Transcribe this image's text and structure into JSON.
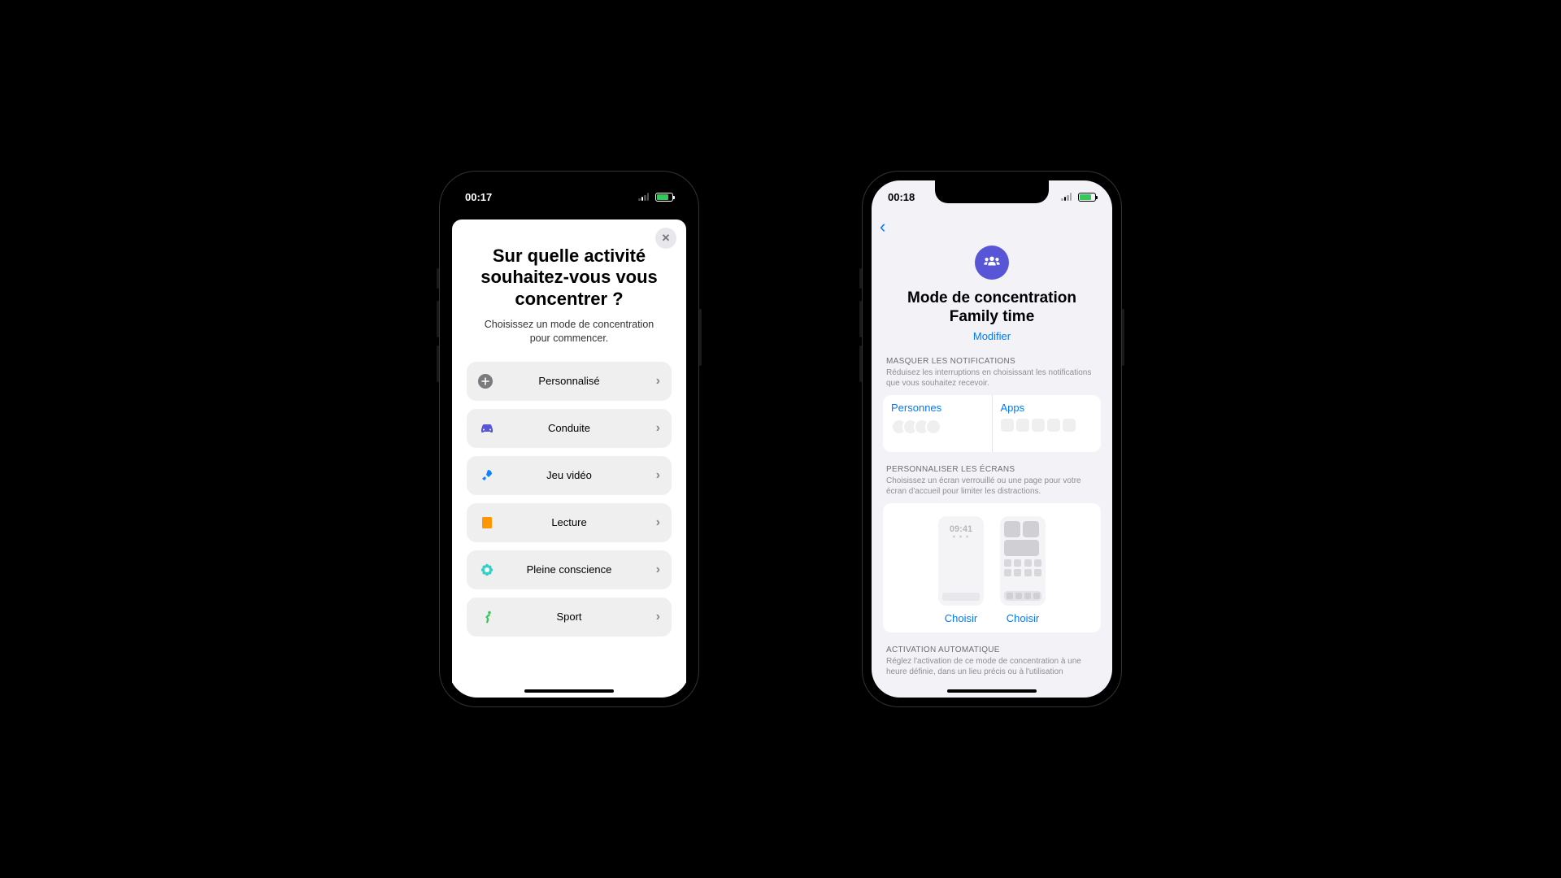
{
  "phone1": {
    "status_time": "00:17",
    "sheet_title": "Sur quelle activité souhaitez-vous vous concentrer ?",
    "sheet_subtitle": "Choisissez un mode de concentration pour commencer.",
    "options": [
      {
        "id": "custom",
        "label": "Personnalisé",
        "icon": "plus",
        "color": "#7a7a7e",
        "shape": "circle"
      },
      {
        "id": "driving",
        "label": "Conduite",
        "icon": "car",
        "color": "#5856d6"
      },
      {
        "id": "gaming",
        "label": "Jeu vidéo",
        "icon": "rocket",
        "color": "#0a84ff"
      },
      {
        "id": "reading",
        "label": "Lecture",
        "icon": "book",
        "color": "#ff9500"
      },
      {
        "id": "mindfulness",
        "label": "Pleine conscience",
        "icon": "flower",
        "color": "#30d0c6"
      },
      {
        "id": "fitness",
        "label": "Sport",
        "icon": "runner",
        "color": "#34c759"
      }
    ]
  },
  "phone2": {
    "status_time": "00:18",
    "title_line1": "Mode de concentration",
    "title_line2": "Family time",
    "modify_label": "Modifier",
    "section_notif_header": "MASQUER LES NOTIFICATIONS",
    "section_notif_desc": "Réduisez les interruptions en choisissant les notifications que vous souhaitez recevoir.",
    "people_label": "Personnes",
    "apps_label": "Apps",
    "section_screens_header": "PERSONNALISER LES ÉCRANS",
    "section_screens_desc": "Choisissez un écran verrouillé ou une page pour votre écran d'accueil pour limiter les distractions.",
    "lock_preview_time": "09:41",
    "choose_label": "Choisir",
    "section_auto_header": "ACTIVATION AUTOMATIQUE",
    "section_auto_desc": "Réglez l'activation de ce mode de concentration à une heure définie, dans un lieu précis ou à l'utilisation"
  }
}
